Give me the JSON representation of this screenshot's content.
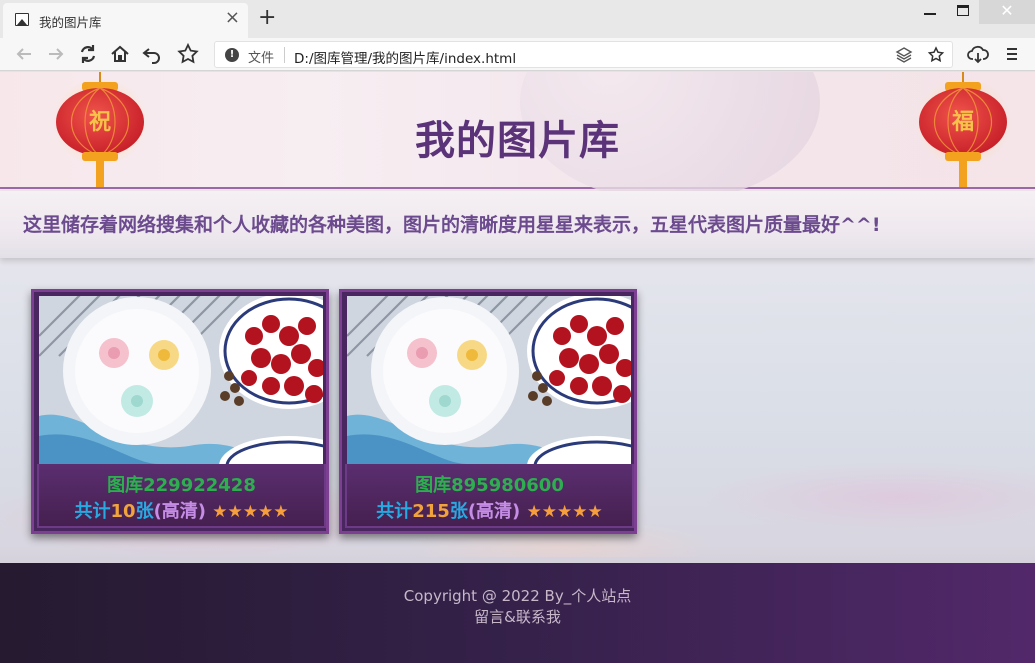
{
  "browser": {
    "tab_title": "我的图片库",
    "tab_close": "×",
    "new_tab": "+",
    "address_scheme": "文件",
    "address_url": "D:/图库管理/我的图片库/index.html"
  },
  "header": {
    "title": "我的图片库",
    "lantern_left_char": "祝",
    "lantern_right_char": "福"
  },
  "intro": {
    "text": "这里储存着网络搜集和个人收藏的各种美图，图片的清晰度用星星来表示，五星代表图片质量最好^^!"
  },
  "galleries": [
    {
      "name": "图库229922428",
      "prefix": "共计",
      "count": "10",
      "unit": "张",
      "quality": "(高清)",
      "stars": "★★★★★",
      "rating": 5
    },
    {
      "name": "图库895980600",
      "prefix": "共计",
      "count": "215",
      "unit": "张",
      "quality": "(高清)",
      "stars": "★★★★★",
      "rating": 5
    }
  ],
  "footer": {
    "copyright": "Copyright @ 2022 By_个人站点",
    "contact": "留言&联系我"
  },
  "colors": {
    "title": "#5a3379",
    "card_border": "#7c3f92",
    "gallery_name": "#2dae4f",
    "count_blue": "#27a9e1",
    "star": "#f59e3b"
  }
}
